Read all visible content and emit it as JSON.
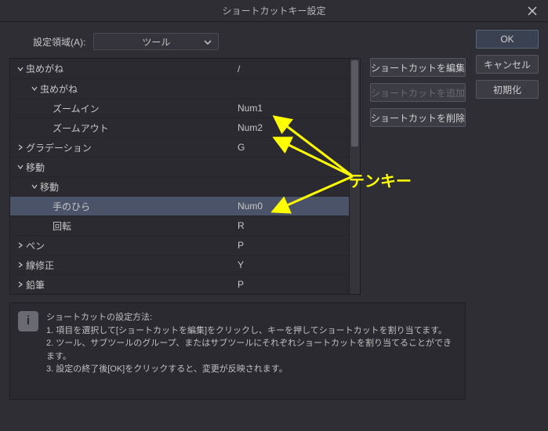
{
  "title": "ショートカットキー設定",
  "settingArea": {
    "label": "設定領域(A):",
    "value": "ツール"
  },
  "tree": [
    {
      "name": "虫めがね",
      "key": "/",
      "indent": 0,
      "caret": "down"
    },
    {
      "name": "虫めがね",
      "key": "",
      "indent": 1,
      "caret": "down"
    },
    {
      "name": "ズームイン",
      "key": "Num1",
      "indent": 2,
      "caret": ""
    },
    {
      "name": "ズームアウト",
      "key": "Num2",
      "indent": 2,
      "caret": ""
    },
    {
      "name": "グラデーション",
      "key": "G",
      "indent": 0,
      "caret": "right"
    },
    {
      "name": "移動",
      "key": "",
      "indent": 0,
      "caret": "down"
    },
    {
      "name": "移動",
      "key": "",
      "indent": 1,
      "caret": "down"
    },
    {
      "name": "手のひら",
      "key": "Num0",
      "indent": 2,
      "caret": "",
      "selected": true
    },
    {
      "name": "回転",
      "key": "R",
      "indent": 2,
      "caret": ""
    },
    {
      "name": "ペン",
      "key": "P",
      "indent": 0,
      "caret": "right"
    },
    {
      "name": "線修正",
      "key": "Y",
      "indent": 0,
      "caret": "right"
    },
    {
      "name": "鉛筆",
      "key": "P",
      "indent": 0,
      "caret": "right"
    }
  ],
  "sideButtons": {
    "edit": "ショートカットを編集",
    "add": "ショートカットを追加",
    "delete": "ショートカットを削除"
  },
  "rightButtons": {
    "ok": "OK",
    "cancel": "キャンセル",
    "reset": "初期化"
  },
  "info": {
    "title": "ショートカットの設定方法:",
    "line1": "1. 項目を選択して[ショートカットを編集]をクリックし、キーを押してショートカットを割り当てます。",
    "line2": "2. ツール、サブツールのグループ、またはサブツールにそれぞれショートカットを割り当てることができます。",
    "line3": "3. 設定の終了後[OK]をクリックすると、変更が反映されます。"
  },
  "annotation": "テンキー"
}
